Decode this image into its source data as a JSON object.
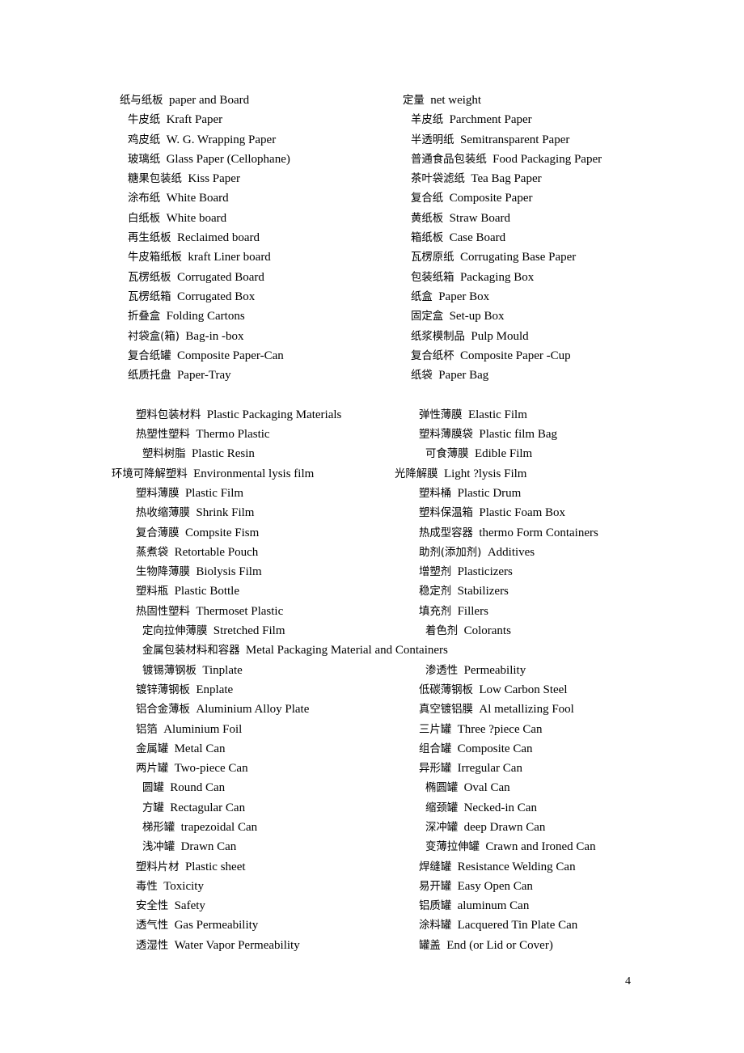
{
  "document": {
    "page_number": "4"
  },
  "glossary": {
    "rows": [
      {
        "indent": "i0",
        "left_term": "纸与纸板",
        "left_gloss": "paper and Board",
        "right_term": "定量",
        "right_gloss": "net weight"
      },
      {
        "indent": "i2",
        "left_term": "牛皮纸",
        "left_gloss": "Kraft Paper",
        "right_term": "羊皮纸",
        "right_gloss": "Parchment Paper"
      },
      {
        "indent": "i2",
        "left_term": "鸡皮纸",
        "left_gloss": "W. G. Wrapping Paper",
        "right_term": "半透明纸",
        "right_gloss": "Semitransparent Paper"
      },
      {
        "indent": "i2",
        "left_term": "玻璃纸",
        "left_gloss": "Glass Paper (Cellophane)",
        "right_term": "普通食品包装纸",
        "right_gloss": "Food Packaging Paper"
      },
      {
        "indent": "i2",
        "left_term": "糖果包装纸",
        "left_gloss": "Kiss Paper",
        "right_term": "茶叶袋滤纸",
        "right_gloss": "Tea Bag Paper"
      },
      {
        "indent": "i2",
        "left_term": "涂布纸",
        "left_gloss": "White Board",
        "right_term": "复合纸",
        "right_gloss": "Composite Paper"
      },
      {
        "indent": "i2",
        "left_term": "白纸板",
        "left_gloss": "White board",
        "right_term": "黄纸板",
        "right_gloss": "Straw Board"
      },
      {
        "indent": "i2",
        "left_term": "再生纸板",
        "left_gloss": "Reclaimed board",
        "right_term": "箱纸板",
        "right_gloss": "Case Board"
      },
      {
        "indent": "i2",
        "left_term": "牛皮箱纸板",
        "left_gloss": "kraft Liner board",
        "right_term": "瓦楞原纸",
        "right_gloss": "Corrugating Base Paper"
      },
      {
        "indent": "i2",
        "left_term": "瓦楞纸板",
        "left_gloss": "Corrugated Board",
        "right_term": "包装纸箱",
        "right_gloss": "Packaging Box"
      },
      {
        "indent": "i2",
        "left_term": "瓦楞纸箱",
        "left_gloss": "Corrugated Box",
        "right_term": "纸盒",
        "right_gloss": "Paper Box"
      },
      {
        "indent": "i2",
        "left_term": "折叠盒",
        "left_gloss": "Folding Cartons",
        "right_term": "固定盒",
        "right_gloss": "Set-up Box"
      },
      {
        "indent": "i2",
        "left_term": "衬袋盒(箱)",
        "left_gloss": "Bag-in -box",
        "right_term": "纸浆模制品",
        "right_gloss": "Pulp Mould"
      },
      {
        "indent": "i2",
        "left_term": "复合纸罐",
        "left_gloss": "Composite Paper-Can",
        "right_term": "复合纸杯",
        "right_gloss": "Composite Paper -Cup"
      },
      {
        "indent": "i2",
        "left_term": "纸质托盘",
        "left_gloss": "Paper-Tray",
        "right_term": "纸袋",
        "right_gloss": "Paper Bag"
      },
      {
        "gap": true
      },
      {
        "indent": "i3",
        "left_term": "塑料包装材料",
        "left_gloss": "Plastic Packaging Materials",
        "right_term": "弹性薄膜",
        "right_gloss": "Elastic Film"
      },
      {
        "indent": "i3",
        "left_term": "热塑性塑料",
        "left_gloss": "Thermo Plastic",
        "right_term": "塑料薄膜袋",
        "right_gloss": "Plastic film Bag"
      },
      {
        "indent": "i4",
        "left_term": "塑料树脂",
        "left_gloss": "Plastic Resin",
        "right_term": "可食薄膜",
        "right_gloss": "Edible Film"
      },
      {
        "indent": "i-1",
        "left_term": "环境可降解塑料",
        "left_gloss": "Environmental lysis film",
        "right_term": "光降解膜",
        "right_gloss": "Light ?lysis Film"
      },
      {
        "indent": "i3",
        "left_term": "塑料薄膜",
        "left_gloss": "Plastic Film",
        "right_term": "塑料桶",
        "right_gloss": "Plastic Drum"
      },
      {
        "indent": "i3",
        "left_term": "热收缩薄膜",
        "left_gloss": "Shrink Film",
        "right_term": "塑料保温箱",
        "right_gloss": "Plastic Foam Box"
      },
      {
        "indent": "i3",
        "left_term": "复合薄膜",
        "left_gloss": "Compsite Fism",
        "right_term": "热成型容器",
        "right_gloss": "thermo Form Containers"
      },
      {
        "indent": "i3",
        "left_term": "蒸煮袋",
        "left_gloss": "Retortable Pouch",
        "right_term": "助剂(添加剂)",
        "right_gloss": "Additives"
      },
      {
        "indent": "i3",
        "left_term": "生物降薄膜",
        "left_gloss": "Biolysis Film",
        "right_term": "增塑剂",
        "right_gloss": "Plasticizers"
      },
      {
        "indent": "i3",
        "left_term": "塑料瓶",
        "left_gloss": "Plastic Bottle",
        "right_term": "稳定剂",
        "right_gloss": "Stabilizers"
      },
      {
        "indent": "i3",
        "left_term": "热固性塑料",
        "left_gloss": "Thermoset Plastic",
        "right_term": "填充剂",
        "right_gloss": "Fillers"
      },
      {
        "indent": "i4",
        "left_term": "定向拉伸薄膜",
        "left_gloss": "Stretched Film",
        "right_term": "着色剂",
        "right_gloss": "Colorants"
      },
      {
        "full": true,
        "indent": "i4",
        "left_term": "金属包装材料和容器",
        "left_gloss": "Metal Packaging Material and Containers"
      },
      {
        "indent": "i4",
        "left_term": "镀锡薄钢板",
        "left_gloss": "Tinplate",
        "right_term": "渗透性",
        "right_gloss": "Permeability"
      },
      {
        "indent": "i3",
        "left_term": "镀锌薄钢板",
        "left_gloss": "Enplate",
        "right_term": "低碳薄钢板",
        "right_gloss": "Low Carbon Steel"
      },
      {
        "indent": "i3",
        "left_term": "铝合金薄板",
        "left_gloss": "Aluminium Alloy Plate",
        "right_term": "真空镀铝膜",
        "right_gloss": "Al metallizing Fool"
      },
      {
        "indent": "i3",
        "left_term": "铝箔",
        "left_gloss": "Aluminium Foil",
        "right_term": "三片罐",
        "right_gloss": "Three ?piece Can"
      },
      {
        "indent": "i3",
        "left_term": "金属罐",
        "left_gloss": "Metal Can",
        "right_term": "组合罐",
        "right_gloss": "Composite Can"
      },
      {
        "indent": "i3",
        "left_term": "两片罐",
        "left_gloss": "Two-piece Can",
        "right_term": "异形罐",
        "right_gloss": "Irregular Can"
      },
      {
        "indent": "i4",
        "left_term": "圆罐",
        "left_gloss": "Round Can",
        "right_term": "椭圆罐",
        "right_gloss": "Oval Can"
      },
      {
        "indent": "i4",
        "left_term": "方罐",
        "left_gloss": "Rectagular Can",
        "right_term": "缩颈罐",
        "right_gloss": "Necked-in Can"
      },
      {
        "indent": "i4",
        "left_term": "梯形罐",
        "left_gloss": "trapezoidal Can",
        "right_term": "深冲罐",
        "right_gloss": "deep Drawn Can"
      },
      {
        "indent": "i4",
        "left_term": "浅冲罐",
        "left_gloss": "Drawn Can",
        "right_term": "变薄拉伸罐",
        "right_gloss": "Crawn and Ironed Can"
      },
      {
        "indent": "i3",
        "left_term": "塑料片材",
        "left_gloss": "Plastic sheet",
        "right_term": "焊缝罐",
        "right_gloss": "Resistance Welding Can"
      },
      {
        "indent": "i3",
        "left_term": "毒性",
        "left_gloss": "Toxicity",
        "right_term": "易开罐",
        "right_gloss": "Easy Open Can"
      },
      {
        "indent": "i3",
        "left_term": "安全性",
        "left_gloss": "Safety",
        "right_term": "铝质罐",
        "right_gloss": "aluminum Can"
      },
      {
        "indent": "i3",
        "left_term": "透气性",
        "left_gloss": "Gas Permeability",
        "right_term": "涂料罐",
        "right_gloss": "Lacquered Tin Plate Can"
      },
      {
        "indent": "i3",
        "left_term": "透湿性",
        "left_gloss": "Water Vapor Permeability",
        "right_term": "罐盖",
        "right_gloss": "End (or Lid or Cover)"
      }
    ]
  }
}
